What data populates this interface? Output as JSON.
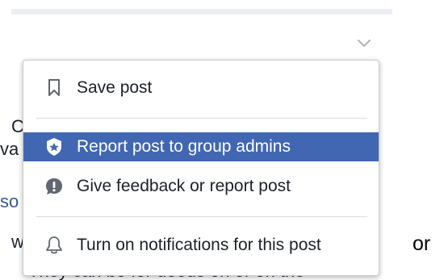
{
  "background": {
    "fragments": [
      {
        "text": "C",
        "style": "plain"
      },
      {
        "text": "va",
        "style": "plain"
      },
      {
        "text": "so",
        "style": "link"
      },
      {
        "text": "w",
        "style": "plain"
      },
      {
        "text": "They can be for deeds on or on the",
        "style": "plain"
      }
    ],
    "outside_text": "or"
  },
  "menu": {
    "items": [
      {
        "label": "Save post",
        "icon": "bookmark-icon"
      },
      {
        "label": "Report post to group admins",
        "icon": "shield-star-icon"
      },
      {
        "label": "Give feedback or report post",
        "icon": "exclamation-bubble-icon"
      },
      {
        "label": "Turn on notifications for this post",
        "icon": "bell-icon"
      }
    ]
  },
  "colors": {
    "highlight": "#4267b2",
    "text": "#1d2129",
    "icon": "#606770"
  }
}
